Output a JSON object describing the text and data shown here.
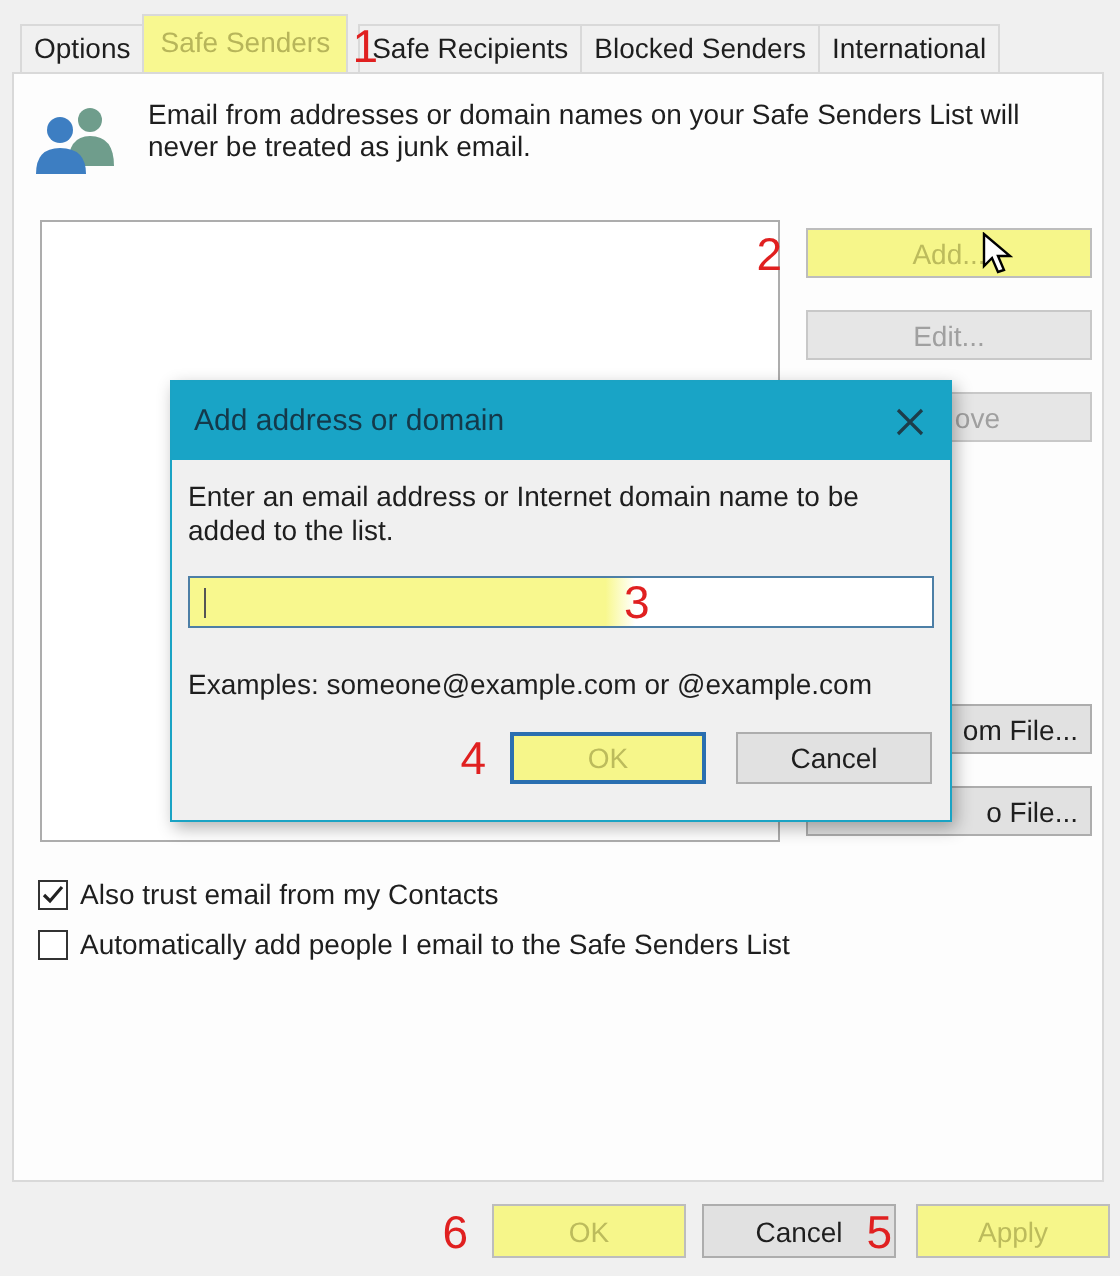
{
  "tabs": [
    {
      "label": "Options",
      "selected": false,
      "highlighted": false
    },
    {
      "label": "Safe Senders",
      "selected": true,
      "highlighted": true,
      "annotation": "1"
    },
    {
      "label": "Safe Recipients",
      "selected": false,
      "highlighted": false
    },
    {
      "label": "Blocked Senders",
      "selected": false,
      "highlighted": false
    },
    {
      "label": "International",
      "selected": false,
      "highlighted": false
    }
  ],
  "description": "Email from addresses or domain names on your Safe Senders List will never be treated as junk email.",
  "top_buttons": [
    {
      "label": "Add...",
      "disabled": true,
      "highlighted": true,
      "annotation": "2"
    },
    {
      "label": "Edit...",
      "disabled": true,
      "highlighted": false
    },
    {
      "label": "ove",
      "disabled": true,
      "highlighted": false
    }
  ],
  "bottom_buttons": [
    {
      "label": "om File...",
      "disabled": false,
      "highlighted": false
    },
    {
      "label": "o File...",
      "disabled": false,
      "highlighted": false
    }
  ],
  "checkboxes": [
    {
      "label": "Also trust email from my Contacts",
      "checked": true
    },
    {
      "label": "Automatically add people I email to the Safe Senders List",
      "checked": false
    }
  ],
  "dialog": {
    "title": "Add address or domain",
    "prompt": "Enter an email address or Internet domain name to be added to the list.",
    "field": {
      "highlighted": true,
      "annotation": "3"
    },
    "example": "Examples: someone@example.com or @example.com",
    "buttons": [
      {
        "label": "OK",
        "disabled": true,
        "highlighted": true,
        "annotation": "4"
      },
      {
        "label": "Cancel",
        "disabled": false,
        "highlighted": false
      }
    ]
  },
  "footer_buttons": [
    {
      "label": "OK",
      "disabled": true,
      "highlighted": true,
      "annotation": "6"
    },
    {
      "label": "Cancel",
      "disabled": false,
      "highlighted": false
    },
    {
      "label": "Apply",
      "disabled": true,
      "highlighted": true,
      "annotation": "5"
    }
  ]
}
